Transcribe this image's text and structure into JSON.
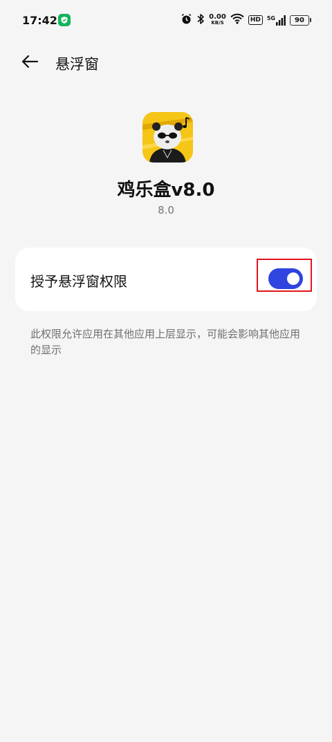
{
  "status_bar": {
    "time": "17:42",
    "net_speed_value": "0.00",
    "net_speed_unit": "KB/S",
    "hd_label": "HD",
    "signal_label": "5G",
    "battery": "90"
  },
  "header": {
    "title": "悬浮窗"
  },
  "app": {
    "name": "鸡乐盒v8.0",
    "version": "8.0"
  },
  "permission": {
    "label": "授予悬浮窗权限",
    "enabled": true,
    "description": "此权限允许应用在其他应用上层显示，可能会影响其他应用的显示"
  },
  "colors": {
    "accent": "#3044e0",
    "highlight": "#e0151b",
    "background": "#f5f5f5"
  }
}
